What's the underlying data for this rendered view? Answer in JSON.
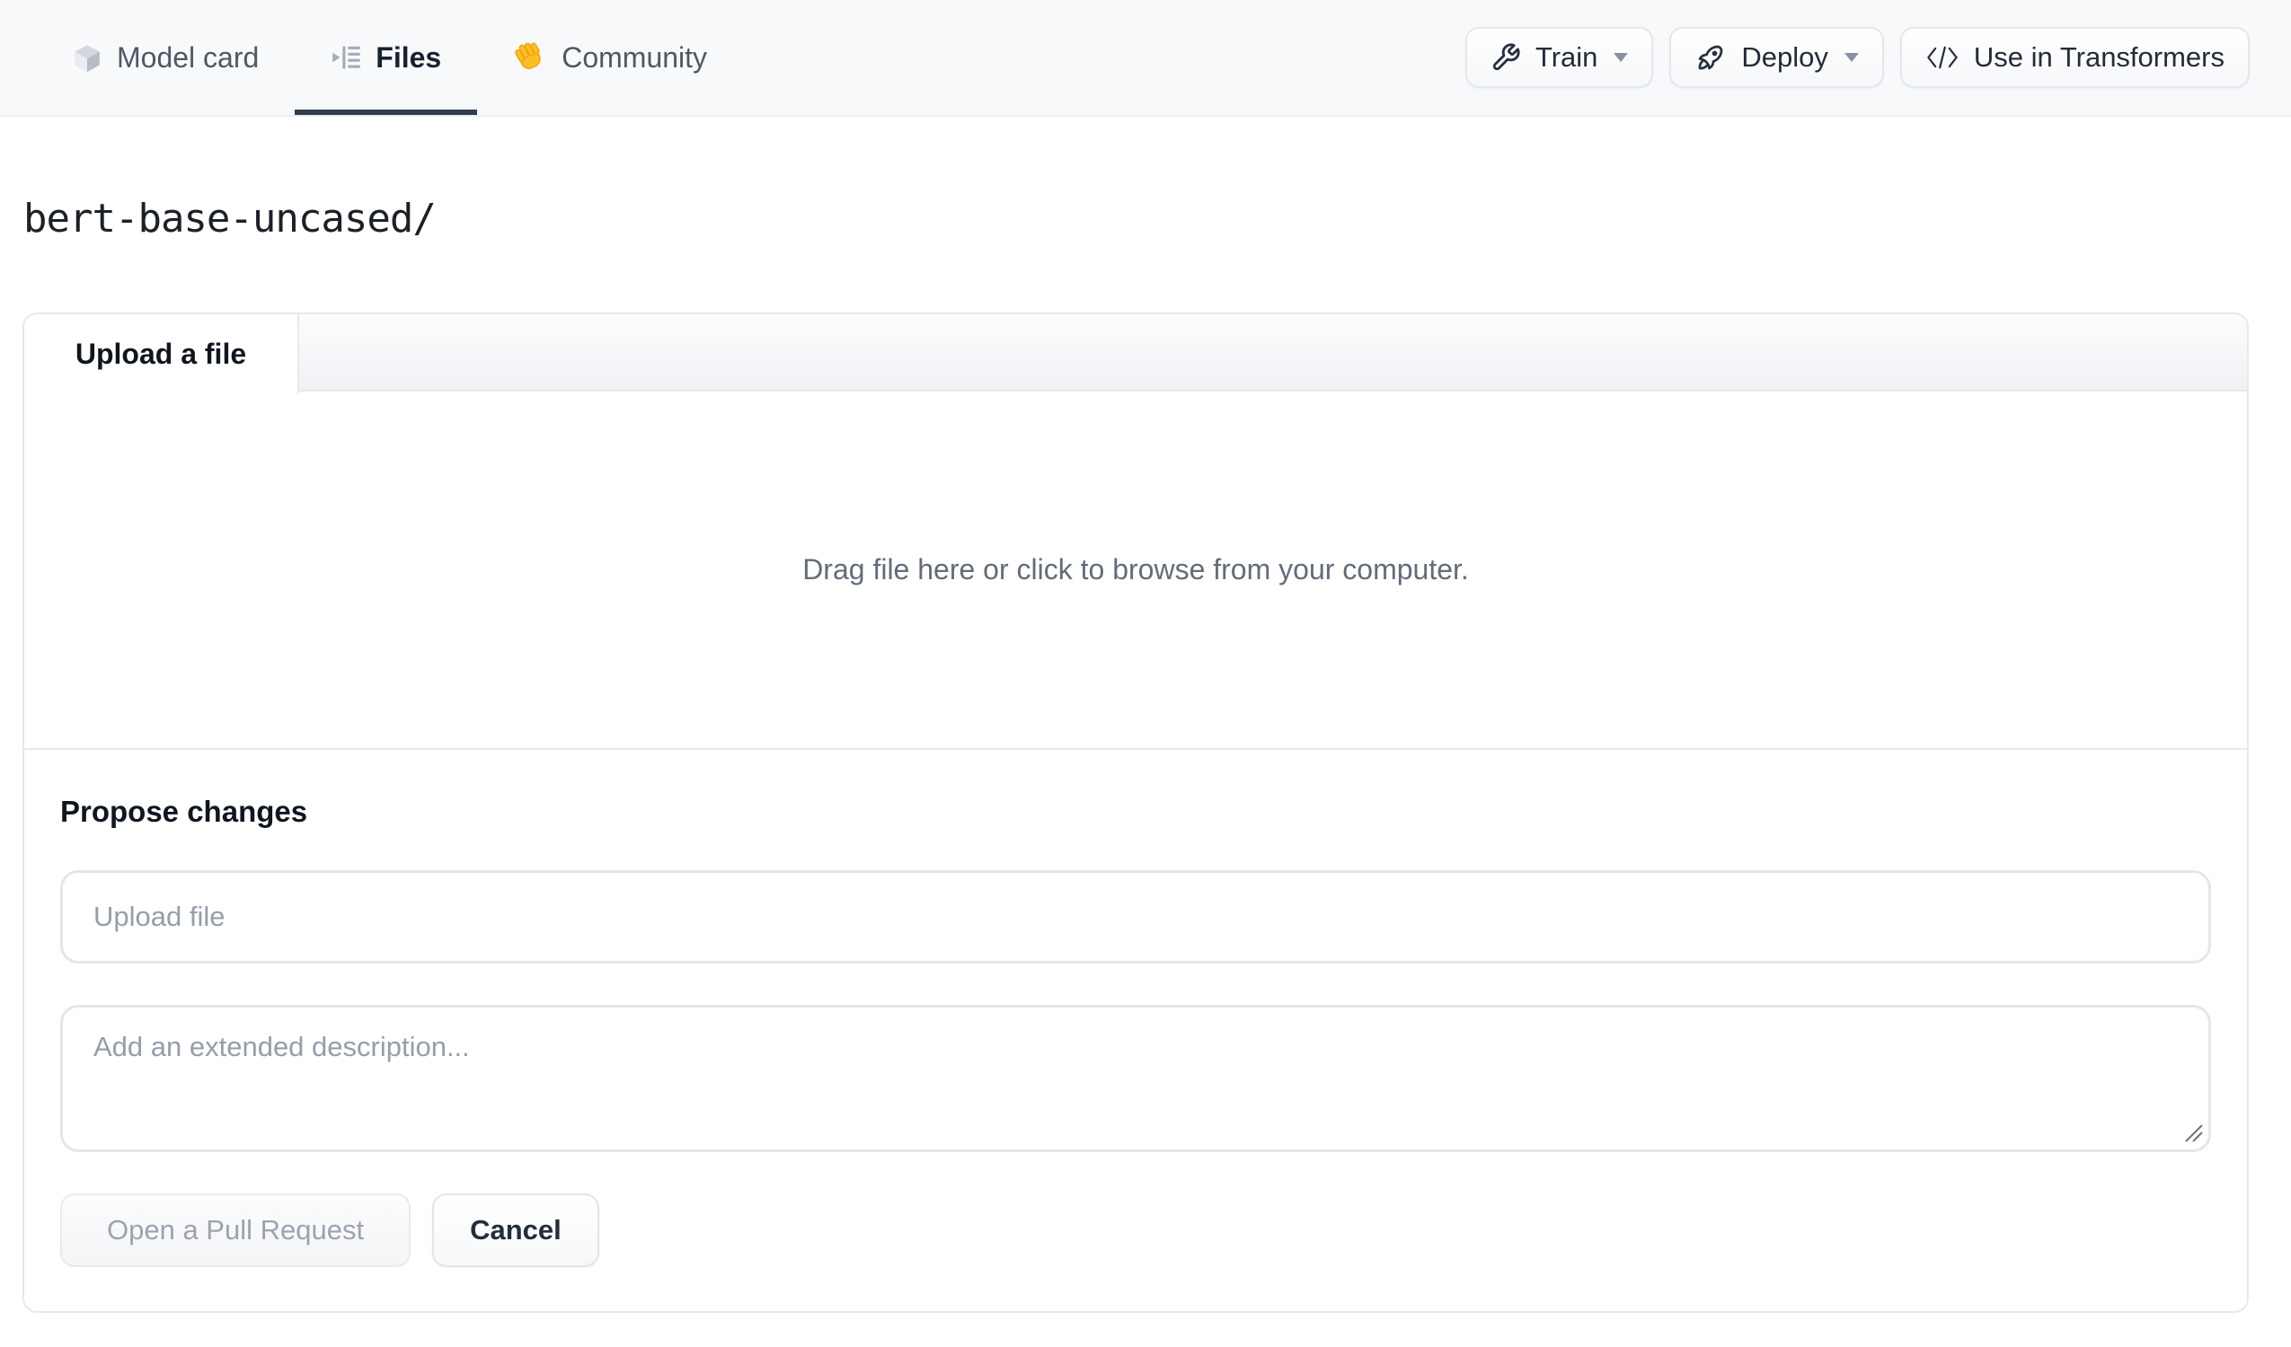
{
  "header": {
    "tabs": [
      {
        "label": "Model card",
        "icon": "cube-icon",
        "active": false
      },
      {
        "label": "Files",
        "icon": "files-list-icon",
        "active": true
      },
      {
        "label": "Community",
        "icon": "waving-hand-icon",
        "active": false
      }
    ],
    "actions": {
      "train_label": "Train",
      "deploy_label": "Deploy",
      "use_in_transformers_label": "Use in Transformers"
    }
  },
  "breadcrumb": {
    "path": "bert-base-uncased/"
  },
  "upload_card": {
    "tab_label": "Upload a file",
    "dropzone_text": "Drag file here or click to browse from your computer.",
    "propose": {
      "heading": "Propose changes",
      "filename_placeholder": "Upload file",
      "filename_value": "",
      "description_placeholder": "Add an extended description...",
      "description_value": "",
      "open_pr_label": "Open a Pull Request",
      "cancel_label": "Cancel"
    }
  },
  "colors": {
    "header_bg": "#f8f9fb",
    "active_tab_underline": "#323e4f",
    "tab_text": "#4e5866",
    "active_tab_text": "#18222f",
    "card_border": "#e7e9ee",
    "muted_text": "#626c7b",
    "placeholder_text": "#949eab",
    "disabled_button_text": "#9ba3af",
    "emoji_hand": "#fbbf24"
  }
}
